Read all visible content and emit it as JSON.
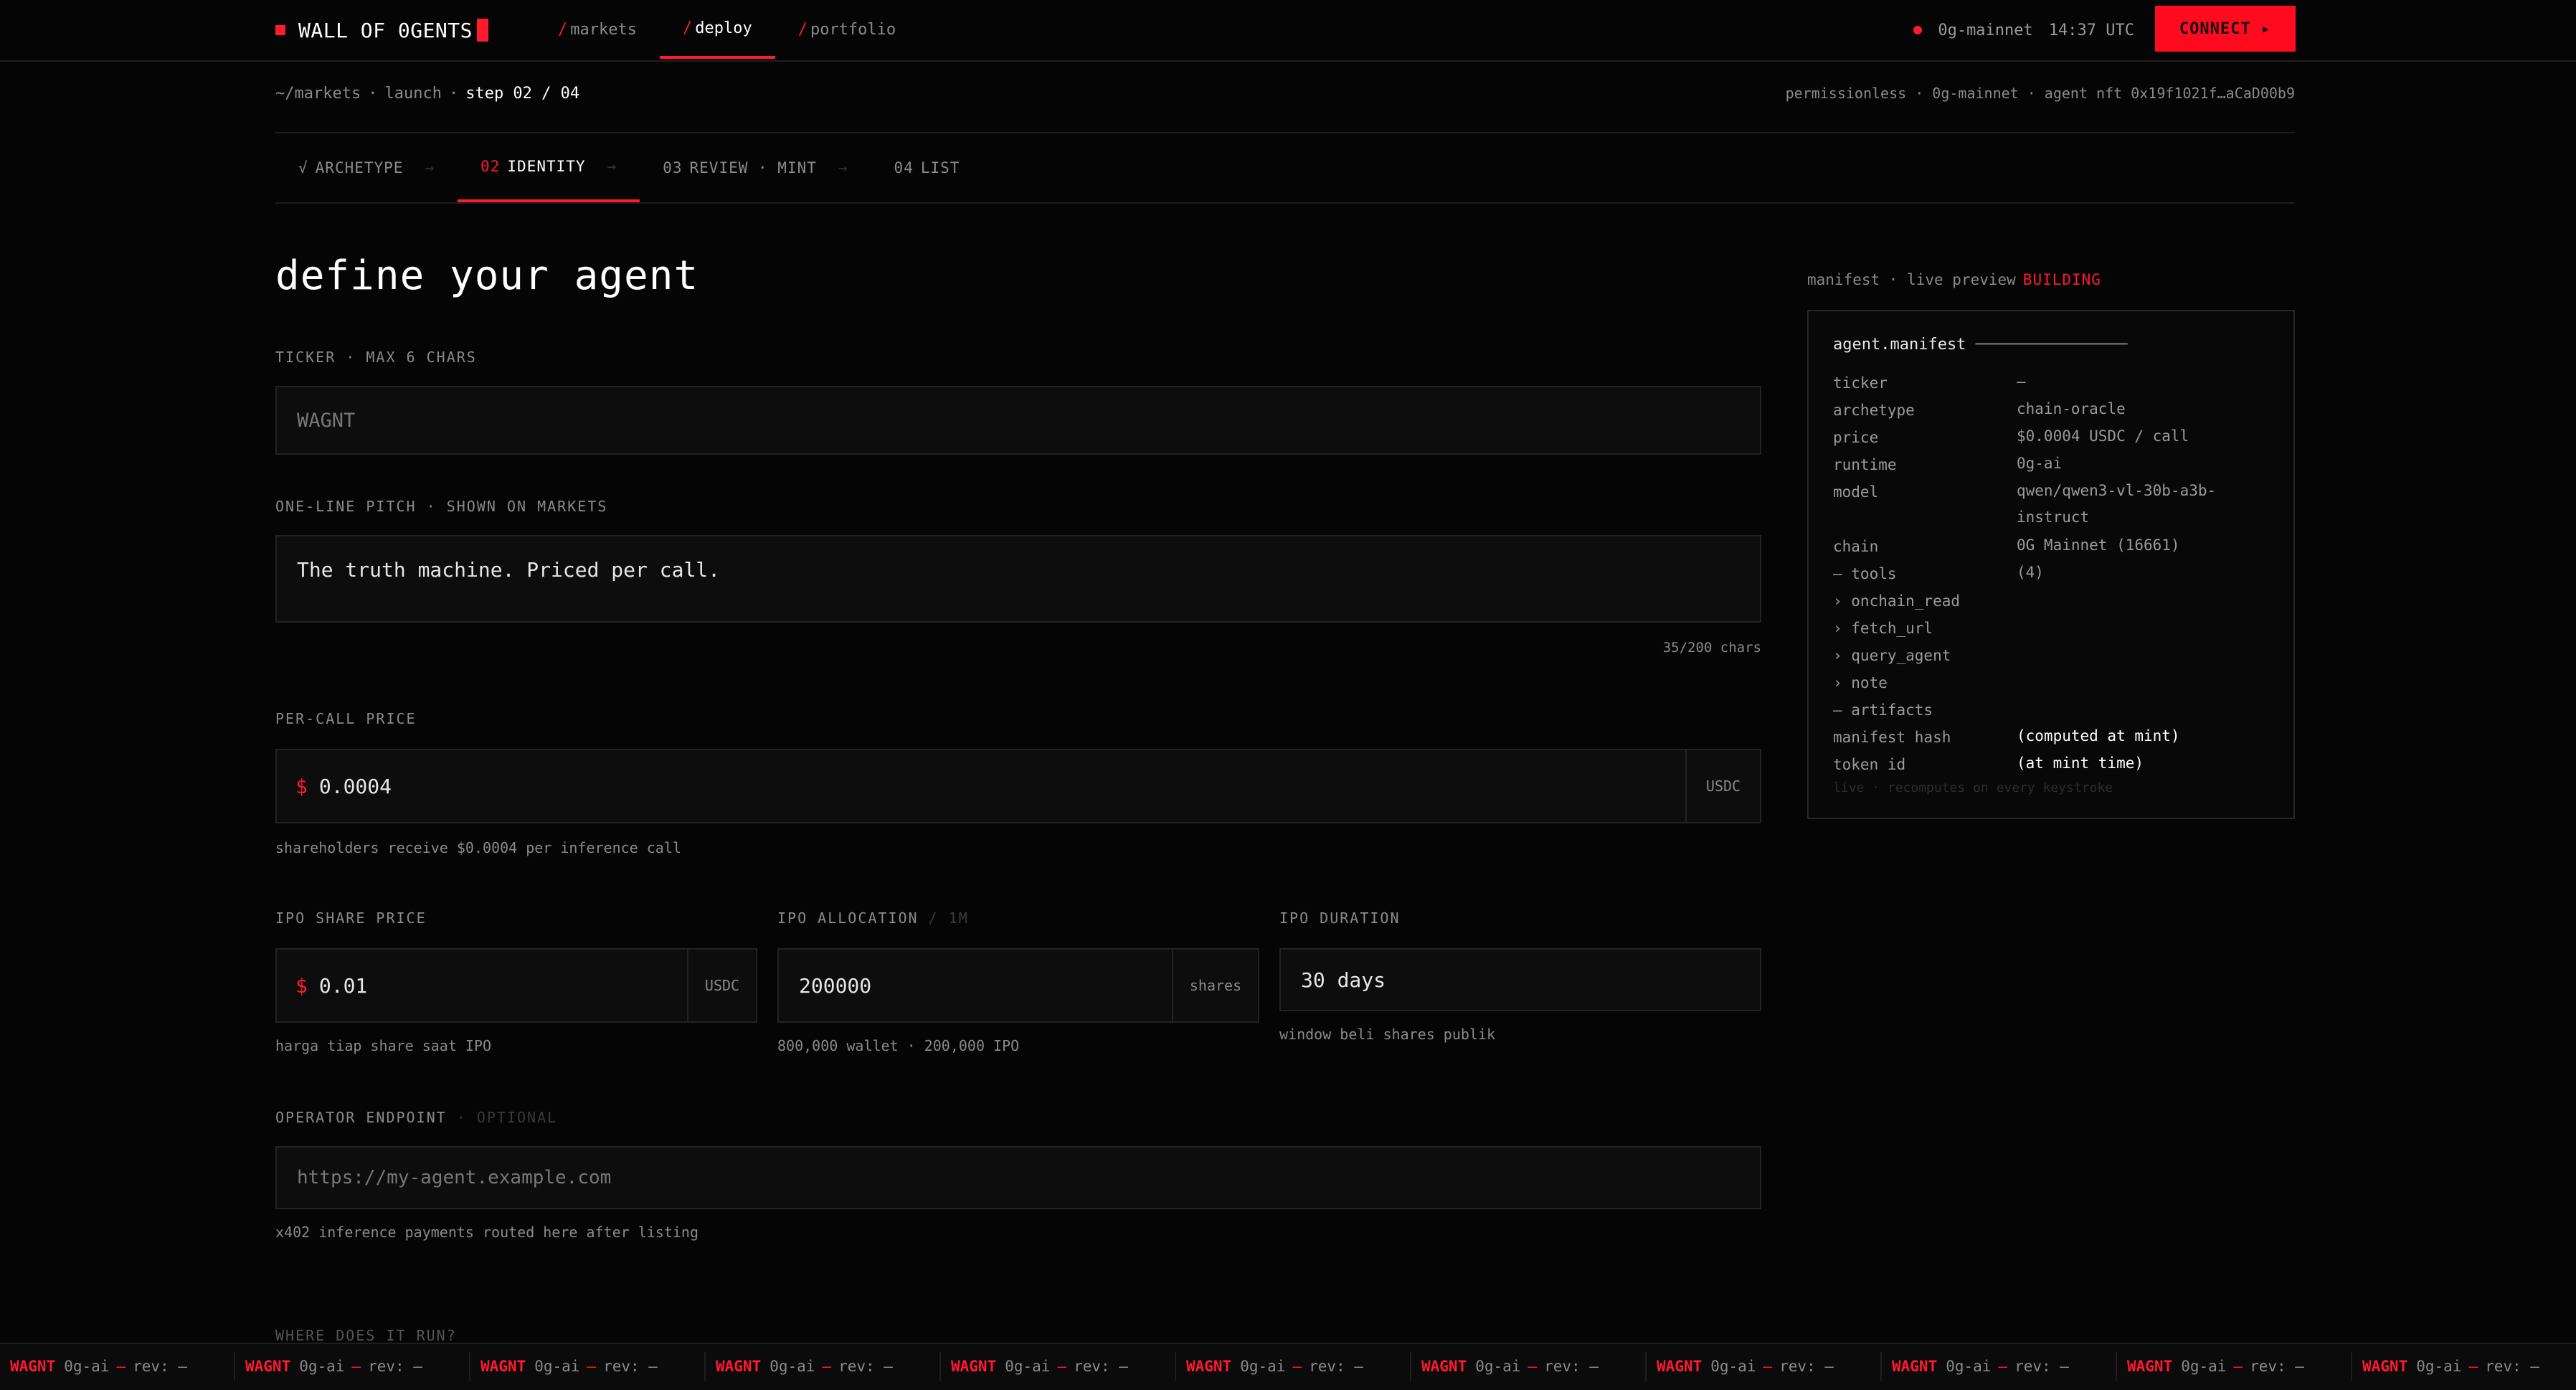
{
  "brand": {
    "name": "WALL OF 0GENTS"
  },
  "nav": [
    {
      "label": "markets"
    },
    {
      "label": "deploy"
    },
    {
      "label": "portfolio"
    }
  ],
  "nav_separator": "/",
  "status": {
    "network": "0g-mainnet",
    "time": "14:37 UTC",
    "connect_label": "CONNECT ▸",
    "dot_color": "#ff1a2e"
  },
  "breadcrumb": {
    "root": "~/markets",
    "section": "launch",
    "current": "step 02 / 04",
    "sep": "·"
  },
  "meta_right": "permissionless · 0g-mainnet · agent nft 0x19f1021f…aCaD00b9",
  "steps": [
    {
      "num": "√",
      "label": "ARCHETYPE"
    },
    {
      "num": "02",
      "label": "IDENTITY"
    },
    {
      "num": "03",
      "label": "REVIEW · MINT"
    },
    {
      "num": "04",
      "label": "LIST"
    }
  ],
  "step_arrow": "→",
  "form": {
    "title": "define your agent",
    "ticker": {
      "label": "TICKER · MAX 6 CHARS",
      "placeholder": "WAGNT"
    },
    "pitch": {
      "label": "ONE-LINE PITCH · SHOWN ON MARKETS",
      "value": "The truth machine. Priced per call.",
      "counter": "35/200 chars"
    },
    "price": {
      "label": "PER-CALL PRICE",
      "symbol": "$",
      "value": "0.0004",
      "unit": "USDC",
      "help": "shareholders receive $0.0004 per inference call"
    },
    "ipo_share_price": {
      "label": "IPO SHARE PRICE",
      "symbol": "$",
      "value": "0.01",
      "unit": "USDC",
      "help": "harga tiap share saat IPO"
    },
    "ipo_allocation": {
      "label": "IPO ALLOCATION",
      "label_suffix": "/ 1M",
      "value": "200000",
      "unit": "shares",
      "help": "800,000 wallet · 200,000 IPO"
    },
    "ipo_duration": {
      "label": "IPO DURATION",
      "value": "30 days",
      "help": "window beli shares publik"
    },
    "endpoint": {
      "label": "OPERATOR ENDPOINT",
      "label_suffix": "· OPTIONAL",
      "placeholder": "https://my-agent.example.com",
      "help": "x402 inference payments routed here after listing"
    },
    "next_section": "WHERE DOES IT RUN?"
  },
  "manifest": {
    "header": "manifest · live preview",
    "badge": "BUILDING",
    "title": "agent.manifest",
    "title_rule": "────────────────",
    "rows": [
      {
        "k": "ticker",
        "v": "—"
      },
      {
        "k": "archetype",
        "v": "chain-oracle"
      },
      {
        "k": "price",
        "v": "$0.0004 USDC / call"
      },
      {
        "k": "runtime",
        "v": "0g-ai"
      },
      {
        "k": "model",
        "v": "qwen/qwen3-vl-30b-a3b-instruct"
      },
      {
        "k": "chain",
        "v": "0G Mainnet (16661)"
      },
      {
        "k": "— tools",
        "v": "(4)"
      },
      {
        "k": "› onchain_read",
        "v": ""
      },
      {
        "k": "› fetch_url",
        "v": ""
      },
      {
        "k": "› query_agent",
        "v": ""
      },
      {
        "k": "› note",
        "v": ""
      },
      {
        "k": "— artifacts",
        "v": ""
      },
      {
        "k": "manifest hash",
        "v": "(computed at mint)"
      },
      {
        "k": "token id",
        "v": "(at mint time)"
      }
    ],
    "footer": "live · recomputes on every keystroke"
  },
  "ticker_tape": [
    {
      "ticker": "WAGNT",
      "runtime": "0g-ai",
      "rev": "rev: —"
    },
    {
      "ticker": "WAGNT",
      "runtime": "0g-ai",
      "rev": "rev: —"
    },
    {
      "ticker": "WAGNT",
      "runtime": "0g-ai",
      "rev": "rev: —"
    },
    {
      "ticker": "WAGNT",
      "runtime": "0g-ai",
      "rev": "rev: —"
    },
    {
      "ticker": "WAGNT",
      "runtime": "0g-ai",
      "rev": "rev: —"
    },
    {
      "ticker": "WAGNT",
      "runtime": "0g-ai",
      "rev": "rev: —"
    },
    {
      "ticker": "WAGNT",
      "runtime": "0g-ai",
      "rev": "rev: —"
    },
    {
      "ticker": "WAGNT",
      "runtime": "0g-ai",
      "rev": "rev: —"
    },
    {
      "ticker": "WAGNT",
      "runtime": "0g-ai",
      "rev": "rev: —"
    },
    {
      "ticker": "WAGNT",
      "runtime": "0g-ai",
      "rev": "rev: —"
    },
    {
      "ticker": "WAGNT",
      "runtime": "0g-ai",
      "rev": "rev: —"
    }
  ],
  "ticker_dash": "—",
  "colors": {
    "accent": "#ff1a2e",
    "bg": "#050505",
    "panel": "#0d0d0d"
  }
}
